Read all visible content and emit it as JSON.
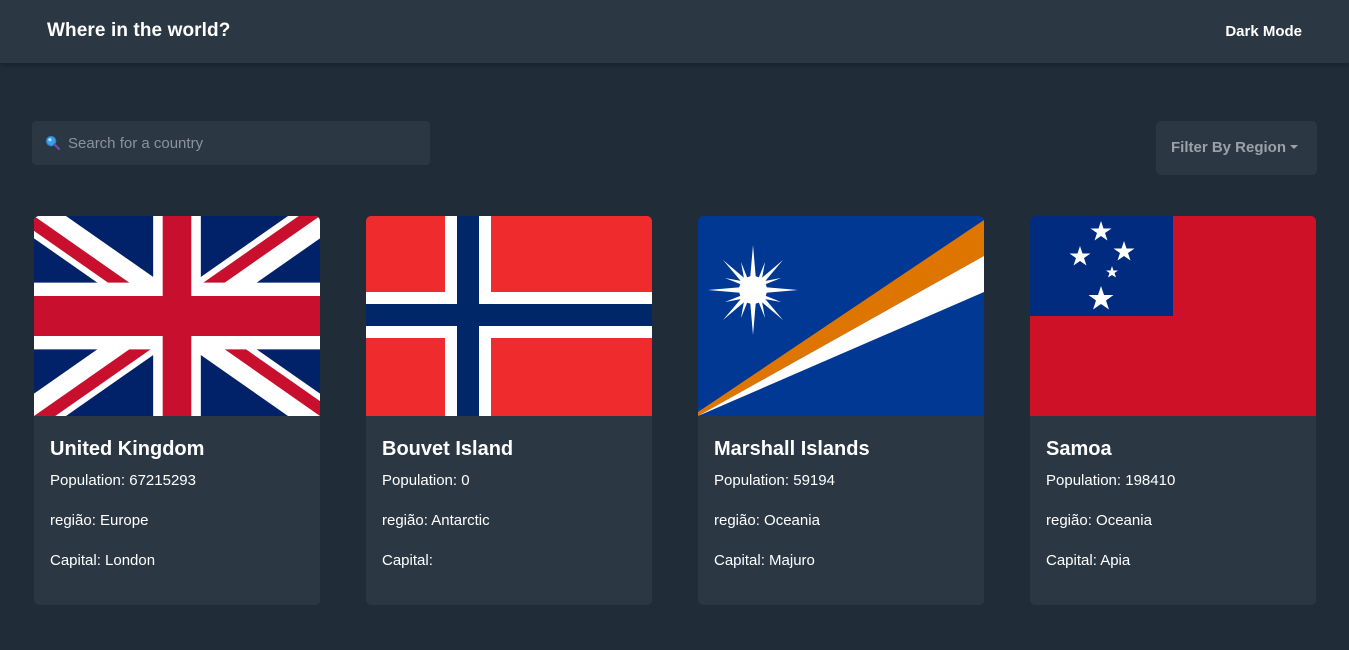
{
  "header": {
    "title": "Where in the world?",
    "dark_mode_label": "Dark Mode"
  },
  "search": {
    "placeholder": "Search for a country",
    "value": "",
    "icon": "search-icon"
  },
  "filter": {
    "label": "Filter By Region",
    "icon": "chevron-down-icon"
  },
  "colors": {
    "background": "#202c37",
    "surface": "#2b3844",
    "text": "#ffffff",
    "muted": "#9aa1a8"
  },
  "cards": [
    {
      "name": "United Kingdom",
      "population_label": "Population:",
      "population": "67215293",
      "region_label": "região:",
      "region": "Europe",
      "capital_label": "Capital:",
      "capital": "London",
      "flag": "united-kingdom-flag"
    },
    {
      "name": "Bouvet Island",
      "population_label": "Population:",
      "population": "0",
      "region_label": "região:",
      "region": "Antarctic",
      "capital_label": "Capital:",
      "capital": "",
      "flag": "bouvet-island-flag"
    },
    {
      "name": "Marshall Islands",
      "population_label": "Population:",
      "population": "59194",
      "region_label": "região:",
      "region": "Oceania",
      "capital_label": "Capital:",
      "capital": "Majuro",
      "flag": "marshall-islands-flag"
    },
    {
      "name": "Samoa",
      "population_label": "Population:",
      "population": "198410",
      "region_label": "região:",
      "region": "Oceania",
      "capital_label": "Capital:",
      "capital": "Apia",
      "flag": "samoa-flag"
    }
  ]
}
